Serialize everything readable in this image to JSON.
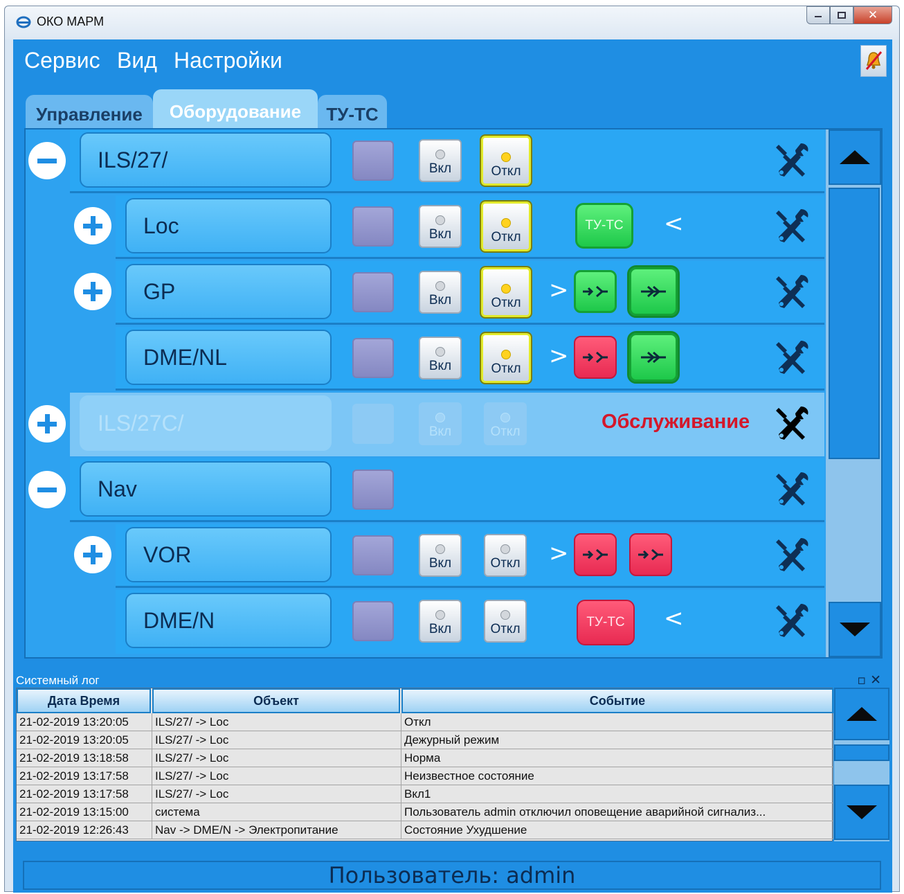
{
  "window": {
    "title": "ОКО МАРМ"
  },
  "menu": {
    "items": [
      "Сервис",
      "Вид",
      "Настройки"
    ]
  },
  "tabs": {
    "items": [
      "Управление",
      "Оборудование",
      "ТУ-ТС"
    ],
    "active": "Оборудование"
  },
  "equipment": {
    "on_label": "Вкл",
    "off_label": "Откл",
    "tutc_label": "ТУ-ТС",
    "maintenance_label": "Обслуживание",
    "rows": [
      {
        "name": "ILS/27/",
        "level": 0,
        "expanded": true,
        "off_lit": true,
        "off_selected": true
      },
      {
        "name": "Loc",
        "level": 1,
        "off_lit": true,
        "off_selected": true,
        "tutc": "green"
      },
      {
        "name": "GP",
        "level": 1,
        "off_lit": true,
        "off_selected": true,
        "switch_a": "green",
        "switch_b": "green"
      },
      {
        "name": "DME/NL",
        "level": 1,
        "off_lit": true,
        "off_selected": true,
        "switch_a": "red",
        "switch_b": "green"
      },
      {
        "name": "ILS/27C/",
        "level": 0,
        "expanded": false,
        "maintenance": true
      },
      {
        "name": "Nav",
        "level": 0,
        "expanded": true
      },
      {
        "name": "VOR",
        "level": 1,
        "switch_a": "red",
        "switch_b": "red"
      },
      {
        "name": "DME/N",
        "level": 1,
        "tutc": "red"
      }
    ]
  },
  "log": {
    "title": "Системный лог",
    "columns": [
      "Дата Время",
      "Объект",
      "Событие"
    ],
    "rows": [
      [
        "21-02-2019 13:20:05",
        "ILS/27/ -> Loc",
        "Откл"
      ],
      [
        "21-02-2019 13:20:05",
        "ILS/27/ -> Loc",
        "Дежурный режим"
      ],
      [
        "21-02-2019 13:18:58",
        "ILS/27/ -> Loc",
        "Норма"
      ],
      [
        "21-02-2019 13:17:58",
        "ILS/27/ -> Loc",
        "Неизвестное состояние"
      ],
      [
        "21-02-2019 13:17:58",
        "ILS/27/ -> Loc",
        "Вкл1"
      ],
      [
        "21-02-2019 13:15:00",
        "система",
        "Пользователь admin отключил оповещение аварийной сигнализ..."
      ],
      [
        "21-02-2019 12:26:43",
        "Nav -> DME/N -> Электропитание",
        "Состояние Ухудшение"
      ]
    ]
  },
  "status": {
    "user": "Пользователь: admin"
  },
  "colors": {
    "accent": "#1f8ee3",
    "panel": "#2ea2f0",
    "alarm": "#d4172a",
    "ok_green": "#1ec84a",
    "fault_red": "#e82a52",
    "indicator_yellow": "#ffd21f"
  }
}
